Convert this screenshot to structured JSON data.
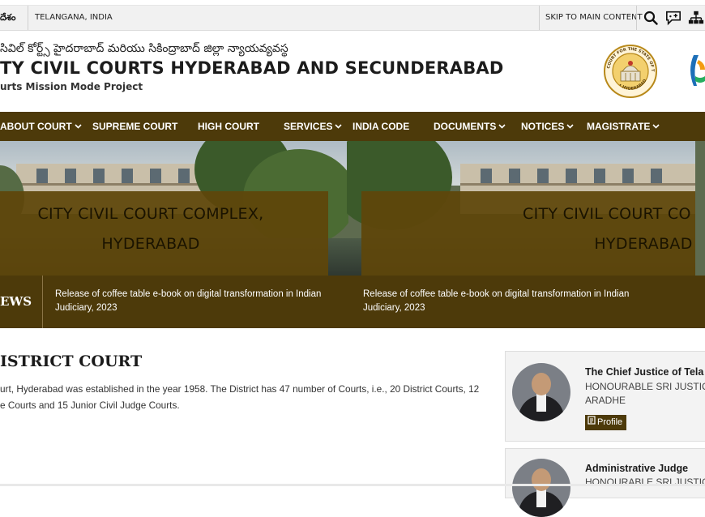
{
  "topbar": {
    "language_cut": "దేశం",
    "location": "TELANGANA, INDIA",
    "skip_link": "SKIP TO MAIN CONTENT",
    "icons": [
      "search-icon",
      "speech-bubble-plus-icon",
      "sitemap-icon"
    ]
  },
  "header": {
    "telugu_title": "సివిల్ కోర్ట్స్ హైదరాబాద్ మరియు సికింద్రాబాద్ జిల్లా న్యాయవ్యవస్థ",
    "title": "TY CIVIL COURTS HYDERABAD AND SECUNDERABAD",
    "subtitle": "urts Mission Mode Project",
    "emblem_text": "COURT FOR THE STATE OF TELANGANA • HYDERABAD"
  },
  "nav": {
    "items": [
      {
        "label": "ABOUT COURT",
        "has_dropdown": true
      },
      {
        "label": "SUPREME COURT",
        "has_dropdown": false
      },
      {
        "label": "HIGH COURT",
        "has_dropdown": false
      },
      {
        "label": "SERVICES",
        "has_dropdown": true
      },
      {
        "label": "INDIA CODE",
        "has_dropdown": false
      },
      {
        "label": "DOCUMENTS",
        "has_dropdown": true
      },
      {
        "label": "NOTICES",
        "has_dropdown": true
      },
      {
        "label": "MAGISTRATE",
        "has_dropdown": true
      }
    ],
    "chevron": "⌄"
  },
  "banner": {
    "slides": [
      {
        "line1": "CITY CIVIL COURT COMPLEX,",
        "line2": "HYDERABAD"
      },
      {
        "line1": "CITY CIVIL COURT CO",
        "line2": "HYDERABAD"
      }
    ]
  },
  "news": {
    "label": "EWS",
    "items": [
      "Release of coffee table e-book on digital transformation in Indian Judiciary, 2023",
      "Release of coffee table e-book on digital transformation in Indian Judiciary, 2023"
    ]
  },
  "main": {
    "title": "ISTRICT COURT",
    "text_line1": "urt, Hyderabad was established in the year 1958. The District has 47 number of Courts, i.e., 20 District Courts, 12",
    "text_line2": "e Courts and 15 Junior Civil Judge Courts."
  },
  "judges": [
    {
      "role": "The Chief Justice of Tela",
      "name_line1": "HONOURABLE SRI JUSTICE",
      "name_line2": "ARADHE",
      "button": "Profile"
    },
    {
      "role": "Administrative Judge",
      "name_line1": "HONOURABLE SRI JUSTICE"
    }
  ],
  "colors": {
    "brand_brown": "#4d3a0a",
    "topbar_bg": "#f1f1f1"
  }
}
